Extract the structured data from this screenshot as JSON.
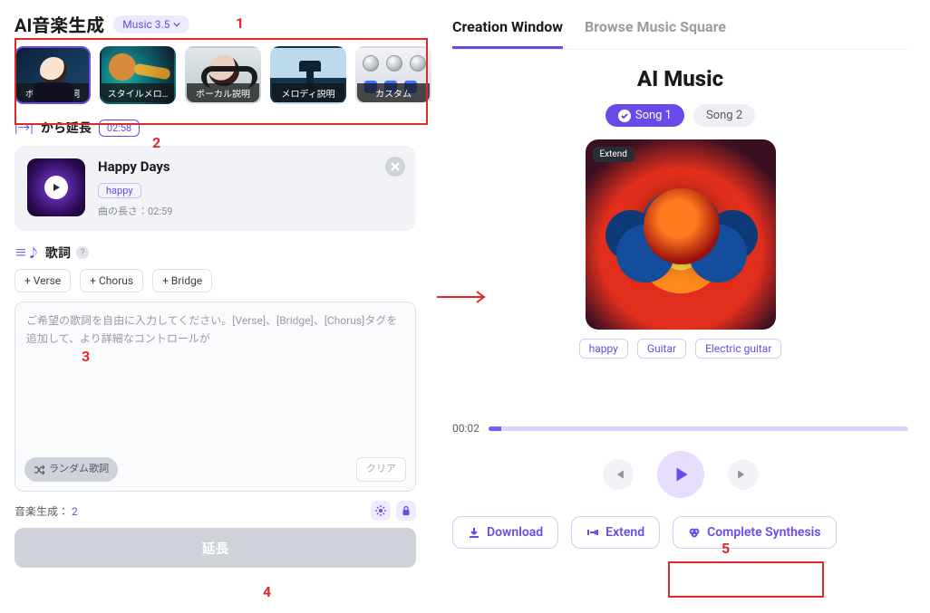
{
  "header": {
    "title": "AI音楽生成",
    "model": "Music 3.5"
  },
  "modes": {
    "items": [
      {
        "label": "ボーカル歌詞"
      },
      {
        "label": "スタイルメロ…"
      },
      {
        "label": "ボーカル説明"
      },
      {
        "label": "メロディ説明"
      },
      {
        "label": "カスタム"
      }
    ]
  },
  "extend": {
    "label": "から延長",
    "time": "02:58"
  },
  "source": {
    "title": "Happy Days",
    "tag": "happy",
    "length_label": "曲の長さ：",
    "length_value": "02:59"
  },
  "lyrics": {
    "title": "歌詞",
    "chips": {
      "verse": "+  Verse",
      "chorus": "+  Chorus",
      "bridge": "+  Bridge"
    },
    "placeholder": "ご希望の歌詞を自由に入力してください。[Verse]、[Bridge]、[Chorus]タグを追加して、より詳細なコントロールが",
    "random": "ランダム歌詞",
    "clear": "クリア"
  },
  "gen": {
    "label": "音楽生成：",
    "count": "2",
    "submit": "延長"
  },
  "right": {
    "tabs": {
      "creation": "Creation Window",
      "browse": "Browse Music Square"
    },
    "title": "AI Music",
    "songs": {
      "s1": "Song 1",
      "s2": "Song 2"
    },
    "art_badge": "Extend",
    "tags": {
      "t1": "happy",
      "t2": "Guitar",
      "t3": "Electric guitar"
    },
    "time": "00:02",
    "actions": {
      "download": "Download",
      "extend": "Extend",
      "complete": "Complete Synthesis"
    }
  },
  "annotations": {
    "n1": "1",
    "n2": "2",
    "n3": "3",
    "n4": "4",
    "n5": "5"
  }
}
